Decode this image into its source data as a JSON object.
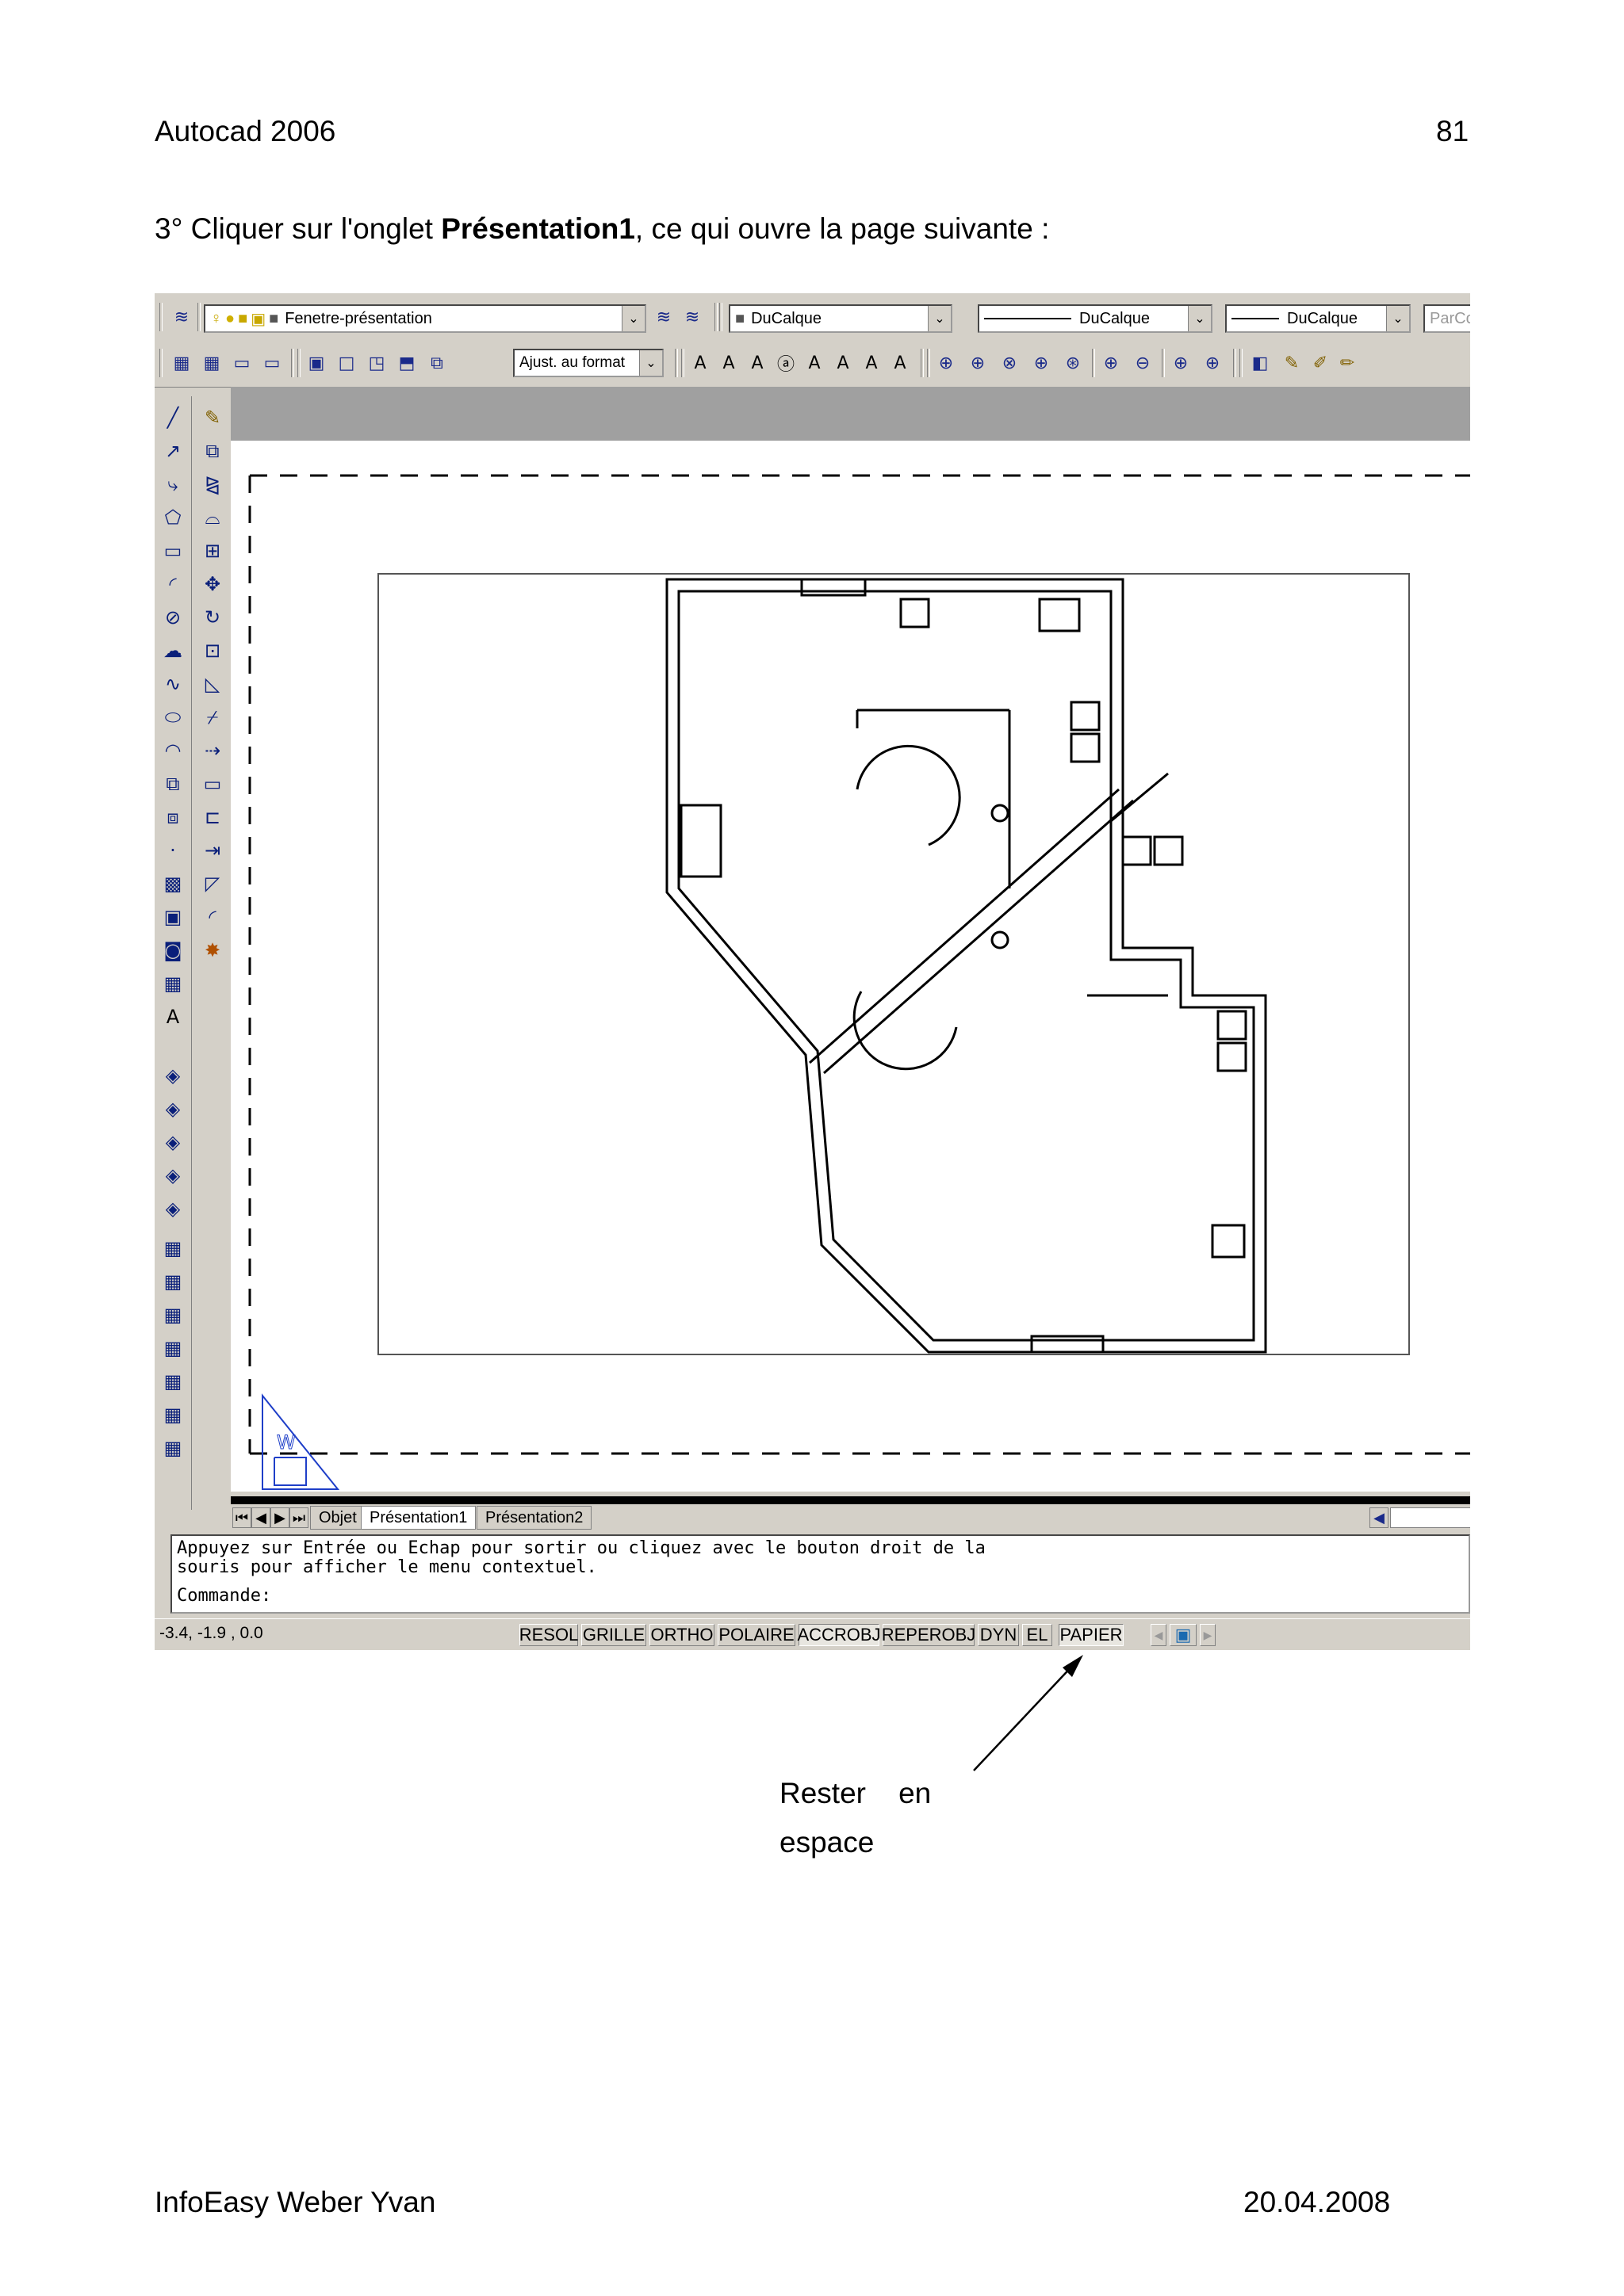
{
  "header": {
    "left": "Autocad 2006",
    "page_number": "81"
  },
  "intro": {
    "prefix": "3° Cliquer sur l'onglet ",
    "bold": "Présentation1",
    "suffix": ", ce qui ouvre la page suivante :"
  },
  "toolbar": {
    "layer_combo": "Fenetre-présentation",
    "color_combo": "DuCalque",
    "linetype_combo": "DuCalque",
    "lineweight_combo": "DuCalque",
    "plotstyle_combo": "ParCo",
    "scale_combo": "Ajust. au format"
  },
  "layout_tabs": [
    "Objet",
    "Présentation1",
    "Présentation2"
  ],
  "command": {
    "line1": "Appuyez sur Entrée ou Echap pour sortir ou cliquez avec le bouton droit de la",
    "line2": "souris pour afficher le menu contextuel.",
    "prompt": "Commande:"
  },
  "status": {
    "coords": "-3.4, -1.9 , 0.0",
    "buttons": [
      "RESOL",
      "GRILLE",
      "ORTHO",
      "POLAIRE",
      "ACCROBJ",
      "REPEROBJ",
      "DYN",
      "EL",
      "PAPIER"
    ],
    "active": [
      "ACCROBJ",
      "PAPIER"
    ]
  },
  "annotation": {
    "line1": "Rester    en",
    "line2": "espace"
  },
  "footer": {
    "left": "InfoEasy Weber Yvan",
    "right": "20.04.2008"
  }
}
